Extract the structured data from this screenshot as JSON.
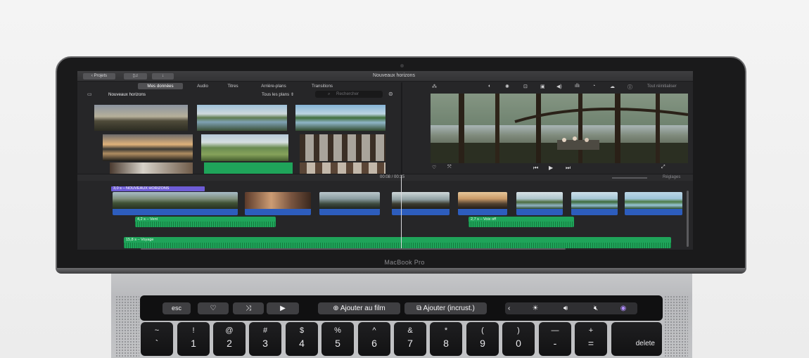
{
  "window": {
    "title": "Nouveaux horizons",
    "back_button": "Projets"
  },
  "tabs": [
    "Mes données",
    "Audio",
    "Titres",
    "Arrière-plans",
    "Transitions"
  ],
  "library": {
    "name": "Nouveaux horizons",
    "filter": "Tous les plans",
    "search_placeholder": "Rechercher"
  },
  "viewer": {
    "reset_label": "Tout réinitialiser"
  },
  "timeline": {
    "timecode": "00:08  /  00:15",
    "settings_label": "Réglages",
    "title_clip": "3,0 s – NOUVEAUX HORIZONS",
    "audio_clips": [
      "4,2 s – Vent",
      "2,7 s – Voix off",
      "15,8 s – Voyage"
    ]
  },
  "device": {
    "model": "MacBook Pro"
  },
  "touch_bar": {
    "esc": "esc",
    "add_to_film": "Ajouter au film",
    "add_inset": "Ajouter (incrust.)"
  },
  "keyboard": {
    "keys": [
      {
        "top": "~",
        "bottom": "`"
      },
      {
        "top": "!",
        "bottom": "1"
      },
      {
        "top": "@",
        "bottom": "2"
      },
      {
        "top": "#",
        "bottom": "3"
      },
      {
        "top": "$",
        "bottom": "4"
      },
      {
        "top": "%",
        "bottom": "5"
      },
      {
        "top": "^",
        "bottom": "6"
      },
      {
        "top": "&",
        "bottom": "7"
      },
      {
        "top": "*",
        "bottom": "8"
      },
      {
        "top": "(",
        "bottom": "9"
      },
      {
        "top": ")",
        "bottom": "0"
      },
      {
        "top": "—",
        "bottom": "-"
      },
      {
        "top": "+",
        "bottom": "="
      }
    ],
    "delete": "delete"
  },
  "colors": {
    "title_clip": "#6e5cd6",
    "video_track": "#2d5dbd",
    "audio_track": "#1fa45a",
    "app_background": "#262628"
  }
}
